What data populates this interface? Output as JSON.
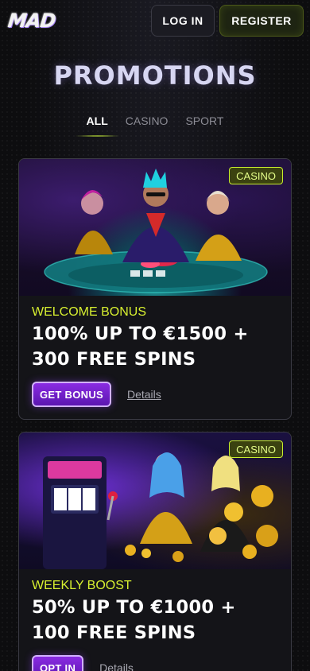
{
  "header": {
    "logo": "MAD",
    "login_label": "LOG IN",
    "register_label": "REGISTER"
  },
  "page_title": "PROMOTIONS",
  "tabs": [
    {
      "label": "ALL",
      "active": true
    },
    {
      "label": "CASINO",
      "active": false
    },
    {
      "label": "SPORT",
      "active": false
    }
  ],
  "promotions": [
    {
      "badge": "CASINO",
      "image": "casino-poker-table-illustration",
      "label": "WELCOME BONUS",
      "headline": "100% UP TO €1500 + 300 FREE SPINS",
      "cta": "GET BONUS",
      "details": "Details"
    },
    {
      "badge": "CASINO",
      "image": "casino-slot-machine-illustration",
      "label": "WEEKLY BOOST",
      "headline": "50% UP TO €1000 + 100 FREE SPINS",
      "cta": "OPT IN",
      "details": "Details"
    }
  ],
  "colors": {
    "accent_lime": "#d8f030",
    "cta_purple": "#7a24d6",
    "background": "#0d0d0f"
  }
}
